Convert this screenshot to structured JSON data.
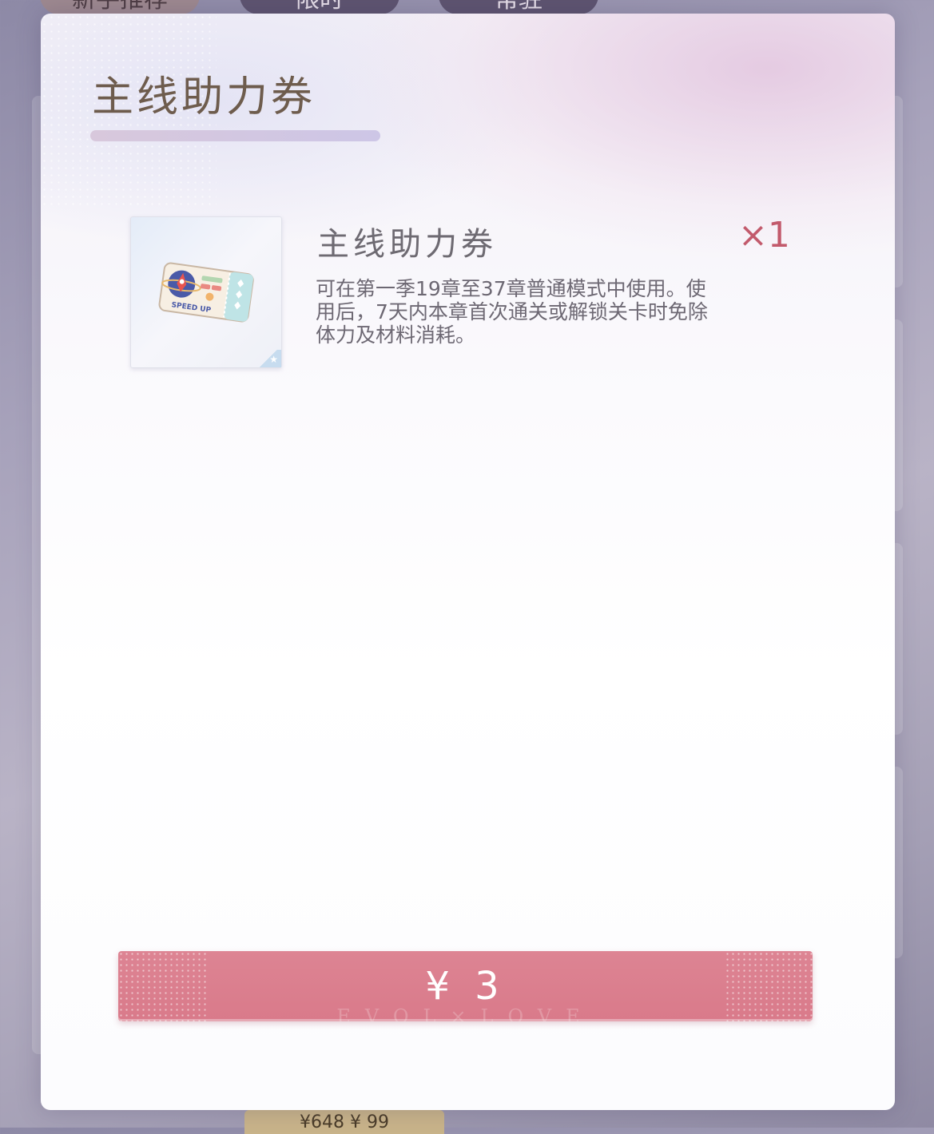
{
  "background": {
    "tabs": [
      "新手推荐",
      "限时",
      "常驻"
    ],
    "price_hint": "¥648 ¥ 99"
  },
  "dialog": {
    "title": "主线助力券",
    "item": {
      "name": "主线助力券",
      "quantity": "×1",
      "description": "可在第一季19章至37章普通模式中使用。使用后，7天内本章首次通关或解锁关卡时免除体力及材料消耗。",
      "icon": "speedup-ticket-icon",
      "icon_text": "SPEED UP"
    },
    "buy_button": {
      "price": "¥ 3",
      "watermark": "EVOL×LOVE"
    }
  },
  "colors": {
    "title": "#6e5c4d",
    "quantity": "#c25a6c",
    "button": "#d97a8a",
    "button_text": "#ffffff"
  }
}
